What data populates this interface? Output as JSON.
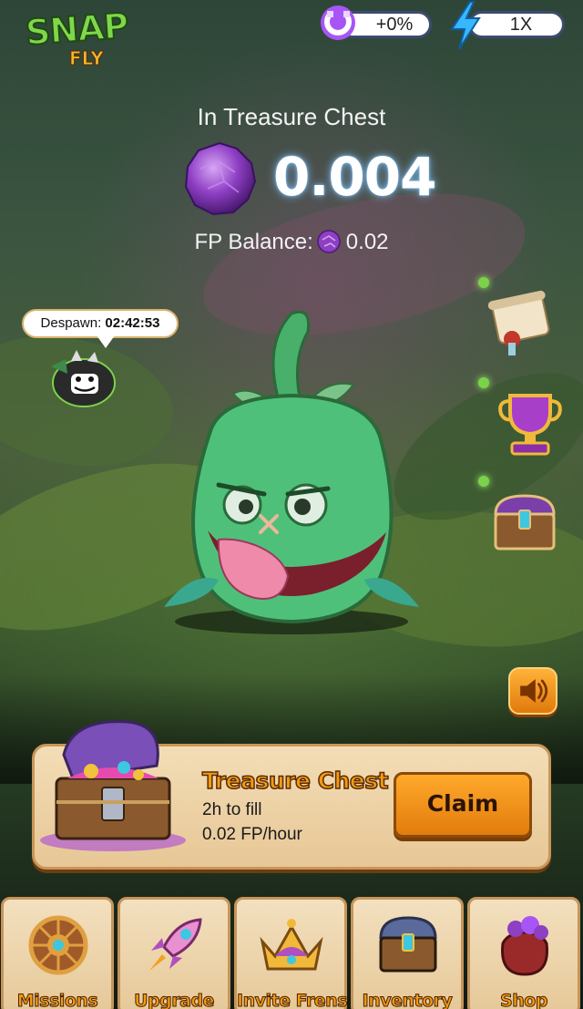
{
  "app": {
    "logo_top": "SNAP",
    "logo_bottom": "FLY"
  },
  "boosts": {
    "magnet": {
      "icon": "magnet-icon",
      "value": "+0%"
    },
    "speed": {
      "icon": "lightning-bolt-icon",
      "value": "1X"
    }
  },
  "chest_status": {
    "title": "In Treasure Chest",
    "amount": "0.004",
    "orb_icon": "purple-orb-icon"
  },
  "balance": {
    "label": "FP Balance:",
    "value": "0.02"
  },
  "creature": {
    "despawn_label": "Despawn:",
    "despawn_time": "02:42:53"
  },
  "side_menu": [
    {
      "name": "scroll-icon"
    },
    {
      "name": "trophy-icon"
    },
    {
      "name": "chest-icon"
    }
  ],
  "sound": {
    "icon": "speaker-icon"
  },
  "treasure_card": {
    "title": "Treasure Chest",
    "fill_time": "2h to fill",
    "rate": "0.02 FP/hour",
    "claim_label": "Claim"
  },
  "nav": {
    "items": [
      {
        "label": "Missions",
        "icon": "wheel-icon"
      },
      {
        "label": "Upgrade",
        "icon": "rocket-icon"
      },
      {
        "label": "Invite Frens",
        "icon": "crown-icon"
      },
      {
        "label": "Inventory",
        "icon": "chest-icon"
      },
      {
        "label": "Shop",
        "icon": "bag-icon"
      }
    ]
  },
  "colors": {
    "accent_orange": "#f29a14",
    "card_bg": "#f3ddb6",
    "orb_purple": "#8e3fc4",
    "monster_green": "#4fc07a"
  }
}
